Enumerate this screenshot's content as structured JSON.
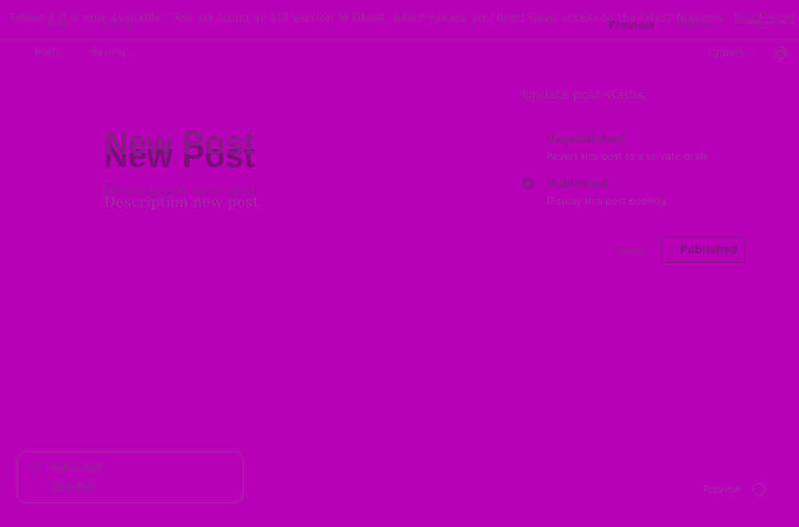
{
  "notice": {
    "text": "Ghost 5.0 is now available - You are using an old version of Ghost, which means you don't have access to the latest features.",
    "link": "Read more"
  },
  "ghost_header": {
    "back_link": "Posts",
    "status": "Saving...",
    "preview": "Preview",
    "publish": "Publish"
  },
  "topbar": {
    "back_link": "Posts",
    "status": "Saving...",
    "update_label": "Update"
  },
  "editor": {
    "title": "New Post",
    "description": "Description new post"
  },
  "status_panel": {
    "title": "Update post status",
    "options": [
      {
        "label": "Unpublished",
        "description": "Revert this post to a private draft",
        "selected": false
      },
      {
        "label": "Published",
        "description": "Display this post publicly",
        "selected": true
      }
    ],
    "cancel_label": "Cancel",
    "confirm_label": "Published"
  },
  "toast": {
    "title": "Published",
    "link": "View Post"
  },
  "help": {
    "label": "Preview"
  },
  "colors": {
    "background": "#b800b8",
    "text": "#8c1c8c"
  }
}
